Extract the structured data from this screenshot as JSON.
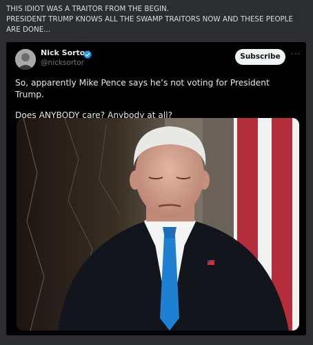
{
  "post": {
    "caption_line1": "THIS IDIOT WAS A TRAITOR FROM THE BEGIN.",
    "caption_line2": "PRESIDENT TRUMP KNOWS ALL THE SWAMP TRAITORS NOW AND THESE PEOPLE ARE DONE..."
  },
  "tweet": {
    "author_name": "Nick Sortor",
    "handle": "@nicksortor",
    "subscribe_label": "Subscribe",
    "more_label": "···",
    "line1": "So, apparently Mike Pence says he’s not voting for President Trump.",
    "line2": "Does ANYBODY care? Anybody at all?"
  },
  "icons": {
    "verified": "verified-badge-icon",
    "more": "more-options-icon"
  },
  "colors": {
    "background": "#2b2d31",
    "card": "#000000",
    "verified": "#1d9bf0",
    "tie": "#1f7fd1"
  }
}
